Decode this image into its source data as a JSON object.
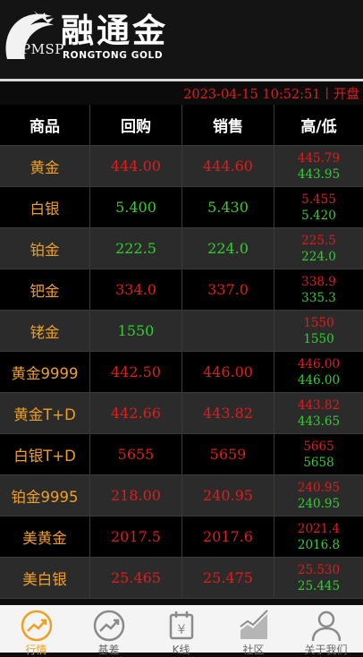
{
  "header": {
    "logo_text": "PMSP",
    "brand_cn": "融通金",
    "brand_en": "RONGTONG GOLD",
    "timestamp": "2023-04-15 10:52:51丨开盘"
  },
  "table": {
    "headers": [
      "商品",
      "回购",
      "销售",
      "高/低"
    ],
    "rows": [
      {
        "name": "黄金",
        "buy": "444.00",
        "buy_color": "red",
        "sell": "444.60",
        "sell_color": "red",
        "high": "445.79",
        "high_color": "red",
        "low": "443.95",
        "low_color": "green"
      },
      {
        "name": "白银",
        "buy": "5.400",
        "buy_color": "green",
        "sell": "5.430",
        "sell_color": "green",
        "high": "5.455",
        "high_color": "red",
        "low": "5.420",
        "low_color": "green"
      },
      {
        "name": "铂金",
        "buy": "222.5",
        "buy_color": "green",
        "sell": "224.0",
        "sell_color": "green",
        "high": "225.5",
        "high_color": "red",
        "low": "224.0",
        "low_color": "green"
      },
      {
        "name": "钯金",
        "buy": "334.0",
        "buy_color": "red",
        "sell": "337.0",
        "sell_color": "red",
        "high": "338.9",
        "high_color": "red",
        "low": "335.3",
        "low_color": "green"
      },
      {
        "name": "铑金",
        "buy": "1550",
        "buy_color": "green",
        "sell": "",
        "sell_color": "red",
        "high": "1550",
        "high_color": "red",
        "low": "1550",
        "low_color": "green"
      },
      {
        "name": "黄金9999",
        "buy": "442.50",
        "buy_color": "red",
        "sell": "446.00",
        "sell_color": "red",
        "high": "446.00",
        "high_color": "red",
        "low": "446.00",
        "low_color": "green"
      },
      {
        "name": "黄金T+D",
        "buy": "442.66",
        "buy_color": "red",
        "sell": "443.82",
        "sell_color": "red",
        "high": "443.82",
        "high_color": "red",
        "low": "443.65",
        "low_color": "green"
      },
      {
        "name": "白银T+D",
        "buy": "5655",
        "buy_color": "red",
        "sell": "5659",
        "sell_color": "red",
        "high": "5665",
        "high_color": "red",
        "low": "5658",
        "low_color": "green"
      },
      {
        "name": "铂金9995",
        "buy": "218.00",
        "buy_color": "red",
        "sell": "240.95",
        "sell_color": "red",
        "high": "240.95",
        "high_color": "red",
        "low": "240.95",
        "low_color": "green"
      },
      {
        "name": "美黄金",
        "buy": "2017.5",
        "buy_color": "red",
        "sell": "2017.6",
        "sell_color": "red",
        "high": "2021.4",
        "high_color": "red",
        "low": "2016.8",
        "low_color": "green"
      },
      {
        "name": "美白银",
        "buy": "25.465",
        "buy_color": "red",
        "sell": "25.475",
        "sell_color": "red",
        "high": "25.530",
        "high_color": "red",
        "low": "25.445",
        "low_color": "green"
      }
    ]
  },
  "nav": {
    "items": [
      {
        "label": "行情",
        "icon": "trend-circle-icon",
        "active": true
      },
      {
        "label": "基差",
        "icon": "trend-circle-icon",
        "active": false
      },
      {
        "label": "K线",
        "icon": "calendar-yen-icon",
        "active": false
      },
      {
        "label": "社区",
        "icon": "chart-area-icon",
        "active": false
      },
      {
        "label": "关于我们",
        "icon": "user-icon",
        "active": false
      }
    ]
  },
  "colors": {
    "accent": "#f0a020",
    "up": "#e31c1c",
    "down": "#30d030",
    "row_even": "#2b2b2b",
    "row_odd": "#000000"
  }
}
